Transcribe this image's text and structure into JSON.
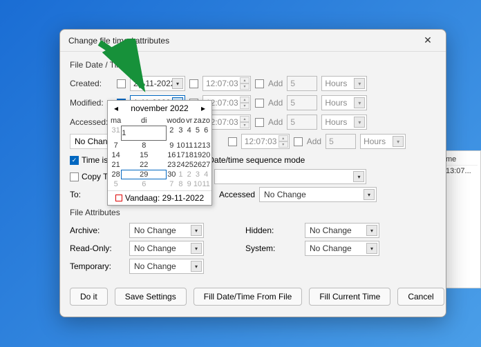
{
  "dialog": {
    "title": "Change file time / attributes",
    "group1_label": "File Date / Time",
    "rows": {
      "created": {
        "label": "Created:",
        "date": "29-11-2022",
        "time": "12:07:03",
        "add": "Add",
        "num": "5",
        "unit": "Hours"
      },
      "modified": {
        "label": "Modified:",
        "date": "1-11-2022",
        "time": "12:07:03",
        "add": "Add",
        "num": "5",
        "unit": "Hours"
      },
      "accessed": {
        "label": "Accessed:",
        "date": "",
        "time": "12:07:03",
        "add": "Add",
        "num": "5",
        "unit": "Hours"
      },
      "extra": {
        "time": "12:07:03",
        "add": "Add",
        "num": "5",
        "unit": "Hours"
      }
    },
    "no_change_label": "No Change",
    "time_is_label": "Time is",
    "copy_label": "Copy T",
    "seq_mode_label": "Date/time sequence mode",
    "to_label": "To:",
    "to_accessed": "Accessed",
    "to_nochange": "No Change",
    "group2_label": "File Attributes",
    "attrs": {
      "archive": {
        "label": "Archive:",
        "val": "No Change"
      },
      "readonly": {
        "label": "Read-Only:",
        "val": "No Change"
      },
      "temporary": {
        "label": "Temporary:",
        "val": "No Change"
      },
      "hidden": {
        "label": "Hidden:",
        "val": "No Change"
      },
      "system": {
        "label": "System:",
        "val": "No Change"
      }
    },
    "buttons": {
      "doit": "Do it",
      "save": "Save Settings",
      "fillfile": "Fill Date/Time From File",
      "fillnow": "Fill Current Time",
      "cancel": "Cancel"
    }
  },
  "calendar": {
    "month_label": "november 2022",
    "day_headers": [
      "ma",
      "di",
      "wo",
      "do",
      "vr",
      "za",
      "zo"
    ],
    "cells": [
      {
        "n": "31",
        "out": true
      },
      {
        "n": "1",
        "sel": true
      },
      {
        "n": "2"
      },
      {
        "n": "3"
      },
      {
        "n": "4"
      },
      {
        "n": "5"
      },
      {
        "n": "6"
      },
      {
        "n": "7"
      },
      {
        "n": "8"
      },
      {
        "n": "9"
      },
      {
        "n": "10"
      },
      {
        "n": "11"
      },
      {
        "n": "12"
      },
      {
        "n": "13"
      },
      {
        "n": "14"
      },
      {
        "n": "15"
      },
      {
        "n": "16"
      },
      {
        "n": "17"
      },
      {
        "n": "18"
      },
      {
        "n": "19"
      },
      {
        "n": "20"
      },
      {
        "n": "21"
      },
      {
        "n": "22"
      },
      {
        "n": "23"
      },
      {
        "n": "24"
      },
      {
        "n": "25"
      },
      {
        "n": "26"
      },
      {
        "n": "27"
      },
      {
        "n": "28"
      },
      {
        "n": "29",
        "today": true
      },
      {
        "n": "30"
      },
      {
        "n": "1",
        "out": true
      },
      {
        "n": "2",
        "out": true
      },
      {
        "n": "3",
        "out": true
      },
      {
        "n": "4",
        "out": true
      },
      {
        "n": "5",
        "out": true
      },
      {
        "n": "6",
        "out": true
      },
      {
        "n": "7",
        "out": true
      },
      {
        "n": "8",
        "out": true
      },
      {
        "n": "9",
        "out": true
      },
      {
        "n": "10",
        "out": true
      },
      {
        "n": "11",
        "out": true
      }
    ],
    "today_label": "Vandaag: 29-11-2022"
  },
  "bg": {
    "col": "me",
    "cell": "13:07..."
  }
}
